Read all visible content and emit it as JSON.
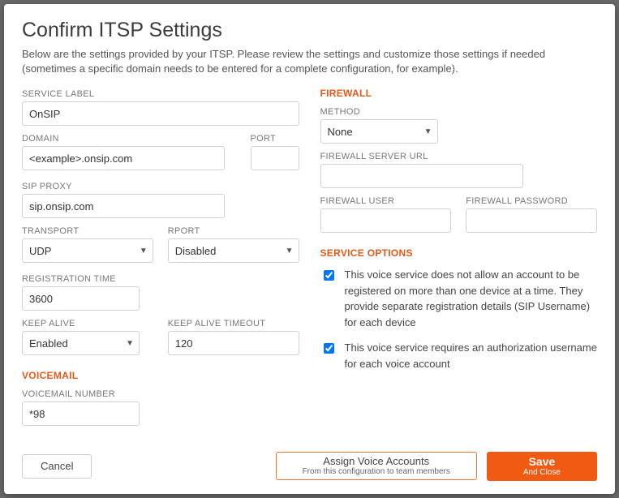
{
  "title": "Confirm ITSP Settings",
  "description": "Below are the settings provided by your ITSP. Please review the settings and customize those settings if needed (sometimes a specific domain needs to be entered for a complete configuration, for example).",
  "labels": {
    "service_label": "SERVICE LABEL",
    "domain": "DOMAIN",
    "port": "PORT",
    "sip_proxy": "SIP PROXY",
    "transport": "TRANSPORT",
    "rport": "RPORT",
    "registration_time": "REGISTRATION TIME",
    "keep_alive": "KEEP ALIVE",
    "keep_alive_timeout": "KEEP ALIVE TIMEOUT",
    "voicemail_section": "VOICEMAIL",
    "voicemail_number": "VOICEMAIL NUMBER",
    "firewall_section": "FIREWALL",
    "method": "METHOD",
    "firewall_server_url": "FIREWALL SERVER URL",
    "firewall_user": "FIREWALL USER",
    "firewall_password": "FIREWALL PASSWORD",
    "service_options_section": "SERVICE OPTIONS"
  },
  "values": {
    "service_label": "OnSIP",
    "domain": "<example>.onsip.com",
    "port": "",
    "sip_proxy": "sip.onsip.com",
    "transport": "UDP",
    "rport": "Disabled",
    "registration_time": "3600",
    "keep_alive": "Enabled",
    "keep_alive_timeout": "120",
    "voicemail_number": "*98",
    "method": "None",
    "firewall_server_url": "",
    "firewall_user": "",
    "firewall_password": ""
  },
  "options": {
    "single_device": {
      "checked": true,
      "text": "This voice service does not allow an account to be registered on more than one device at a time. They provide separate registration details (SIP Username) for each device"
    },
    "auth_username": {
      "checked": true,
      "text": "This voice service requires an authorization username for each voice account"
    }
  },
  "buttons": {
    "cancel": "Cancel",
    "assign_title": "Assign Voice Accounts",
    "assign_sub": "From this configuration to team members",
    "save_title": "Save",
    "save_sub": "And Close"
  }
}
